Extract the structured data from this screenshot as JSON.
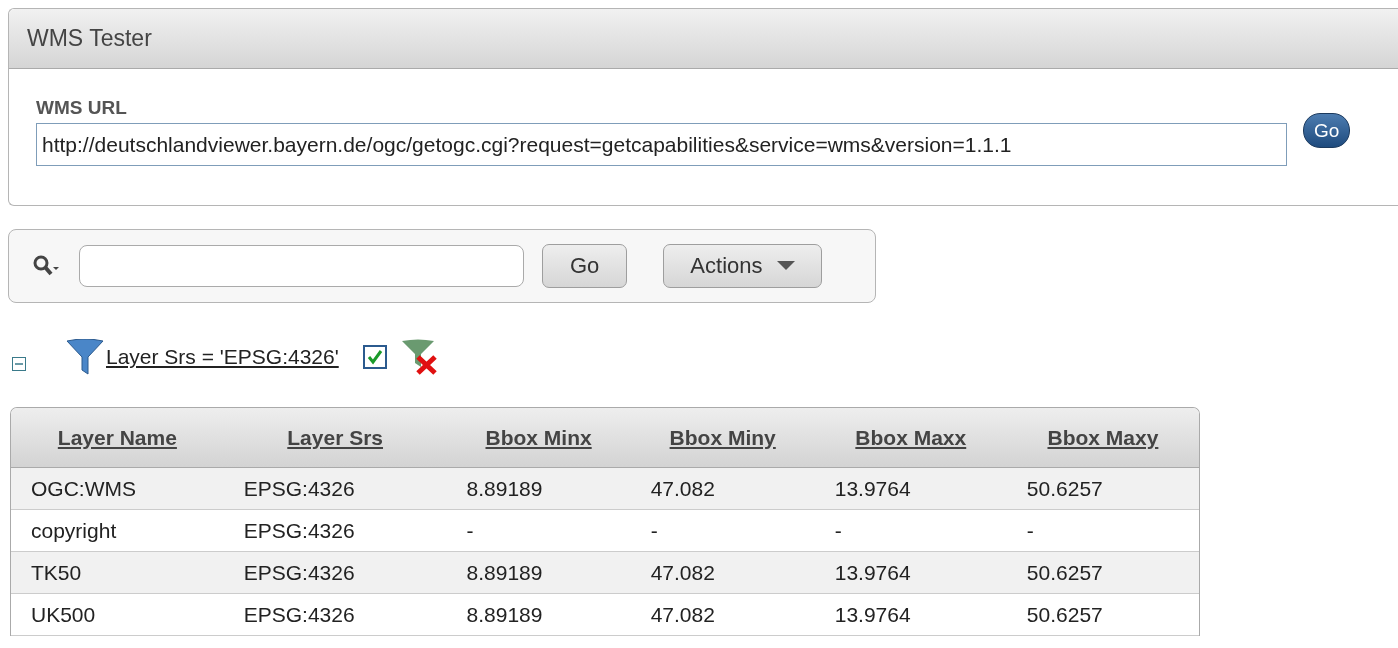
{
  "region": {
    "title": "WMS Tester"
  },
  "url_field": {
    "label": "WMS URL",
    "value": "http://deutschlandviewer.bayern.de/ogc/getogc.cgi?request=getcapabilities&service=wms&version=1.1.1",
    "button": "Go"
  },
  "search_bar": {
    "go_button": "Go",
    "actions_button": "Actions"
  },
  "filter": {
    "expanded": true,
    "text": "Layer Srs = 'EPSG:4326'",
    "enabled": true
  },
  "table": {
    "columns": [
      "Layer Name",
      "Layer Srs",
      "Bbox Minx",
      "Bbox Miny",
      "Bbox Maxx",
      "Bbox Maxy"
    ],
    "rows": [
      [
        "OGC:WMS",
        "EPSG:4326",
        "8.89189",
        "47.082",
        "13.9764",
        "50.6257"
      ],
      [
        "copyright",
        "EPSG:4326",
        "-",
        "-",
        "-",
        "-"
      ],
      [
        "TK50",
        "EPSG:4326",
        "8.89189",
        "47.082",
        "13.9764",
        "50.6257"
      ],
      [
        "UK500",
        "EPSG:4326",
        "8.89189",
        "47.082",
        "13.9764",
        "50.6257"
      ]
    ]
  }
}
